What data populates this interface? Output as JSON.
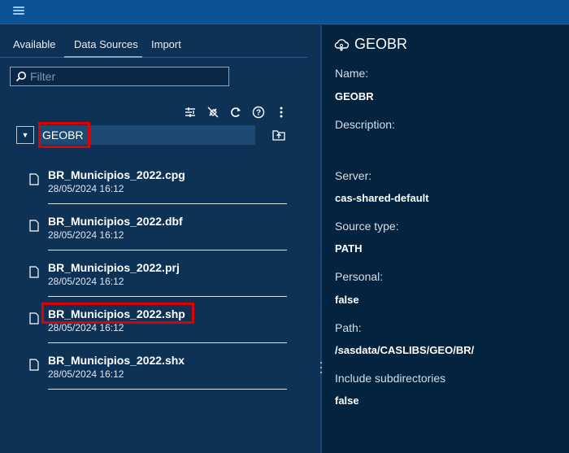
{
  "header": {
    "menu_icon": "hamburger-icon"
  },
  "tabs": [
    {
      "label": "Available"
    },
    {
      "label": "Data Sources"
    },
    {
      "label": "Import"
    }
  ],
  "filter": {
    "placeholder": "Filter",
    "value": ""
  },
  "toolbar": {
    "icons": [
      "sort-filter-icon",
      "disconnect-icon",
      "refresh-icon",
      "help-icon",
      "more-options-icon"
    ]
  },
  "library": {
    "name": "GEOBR",
    "expanded": true
  },
  "files": [
    {
      "name": "BR_Municipios_2022.cpg",
      "date": "28/05/2024 16:12"
    },
    {
      "name": "BR_Municipios_2022.dbf",
      "date": "28/05/2024 16:12"
    },
    {
      "name": "BR_Municipios_2022.prj",
      "date": "28/05/2024 16:12"
    },
    {
      "name": "BR_Municipios_2022.shp",
      "date": "28/05/2024 16:12"
    },
    {
      "name": "BR_Municipios_2022.shx",
      "date": "28/05/2024 16:12"
    }
  ],
  "details": {
    "title": "GEOBR",
    "name_label": "Name:",
    "name_value": "GEOBR",
    "description_label": "Description:",
    "server_label": "Server:",
    "server_value": "cas-shared-default",
    "source_type_label": "Source type:",
    "source_type_value": "PATH",
    "personal_label": "Personal:",
    "personal_value": "false",
    "path_label": "Path:",
    "path_value": "/sasdata/CASLIBS/GEO/BR/",
    "subdirs_label": "Include subdirectories",
    "subdirs_value": "false"
  },
  "colors": {
    "topbar": "#0b5394",
    "left_panel": "#0e3156",
    "right_panel": "#03233f",
    "highlight": "#e00000"
  }
}
